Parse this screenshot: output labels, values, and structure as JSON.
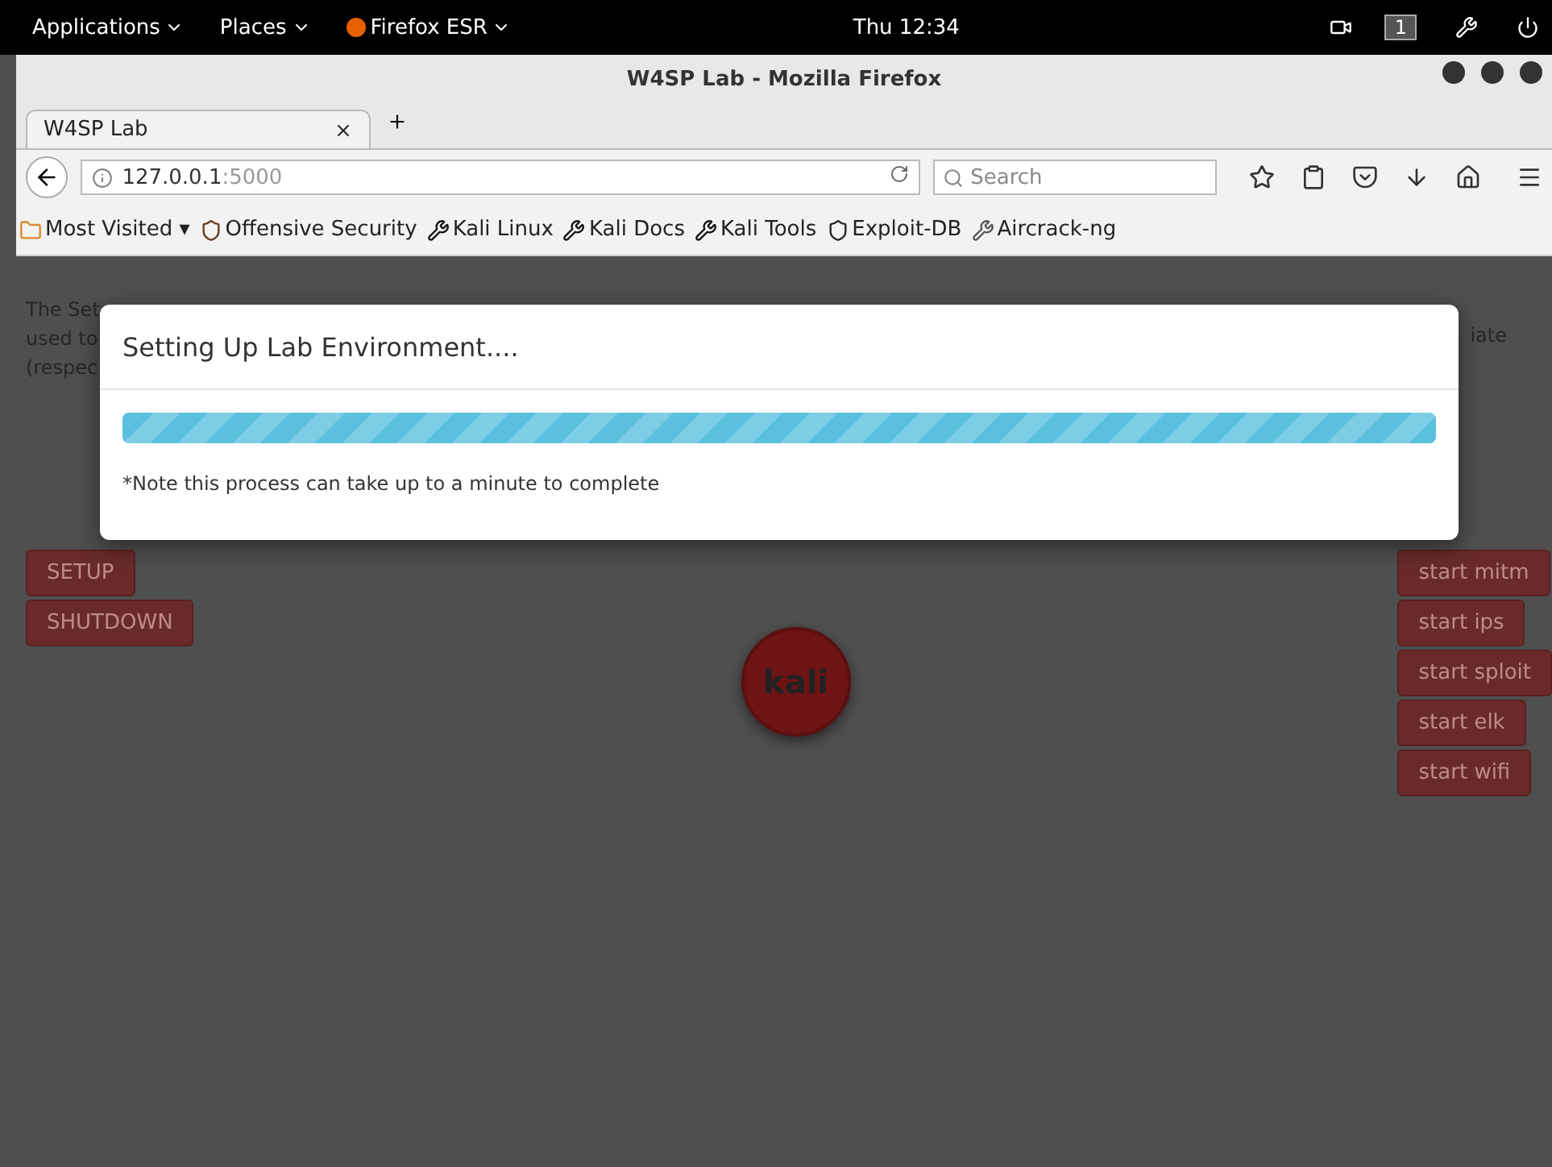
{
  "top_bar": {
    "menus": [
      "Applications",
      "Places",
      "Firefox ESR"
    ],
    "clock": "Thu 12:34",
    "workspace": "1"
  },
  "window": {
    "title": "W4SP Lab - Mozilla Firefox"
  },
  "tabs": [
    {
      "label": "W4SP Lab",
      "selected": true
    }
  ],
  "address_bar": {
    "host": "127.0.0.1",
    "port": ":5000"
  },
  "search": {
    "placeholder": "Search"
  },
  "bookmarks": [
    {
      "label": "Most Visited ▾",
      "kind": "folder"
    },
    {
      "label": "Offensive Security",
      "kind": "offsec"
    },
    {
      "label": "Kali Linux",
      "kind": "kali"
    },
    {
      "label": "Kali Docs",
      "kind": "kali"
    },
    {
      "label": "Kali Tools",
      "kind": "kali"
    },
    {
      "label": "Exploit-DB",
      "kind": "exploit"
    },
    {
      "label": "Aircrack-ng",
      "kind": "aircrack"
    }
  ],
  "page": {
    "intro_left": [
      "The Set",
      "used to",
      "(respec"
    ],
    "intro_right": "iate",
    "left_buttons": [
      "SETUP",
      "SHUTDOWN"
    ],
    "node": "kali",
    "right_buttons": [
      "start mitm",
      "start ips",
      "start sploit",
      "start elk",
      "start wifi"
    ]
  },
  "modal": {
    "title": "Setting Up Lab Environment....",
    "progress": {
      "level": 1
    },
    "note": "*Note this process can take up to a minute to complete"
  }
}
